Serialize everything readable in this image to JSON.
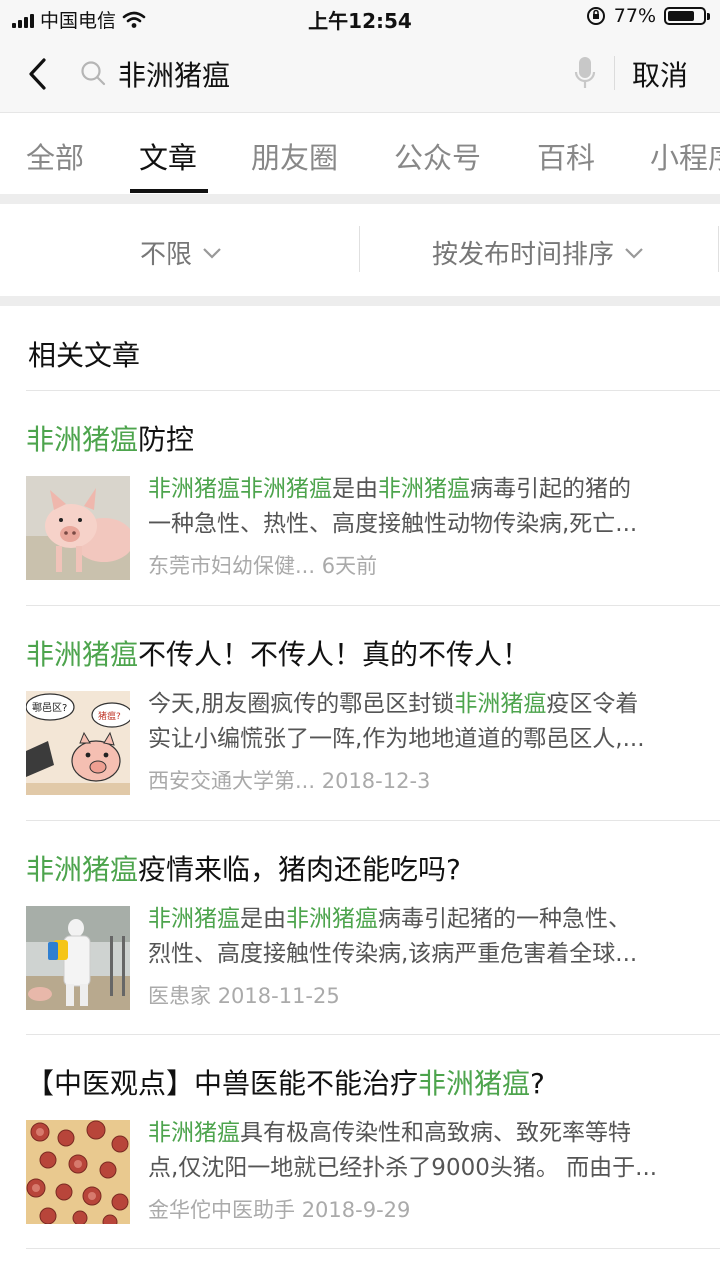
{
  "status_bar": {
    "carrier": "中国电信",
    "time": "上午12:54",
    "battery": "77%",
    "battery_level": 0.77
  },
  "search": {
    "query": "非洲猪瘟",
    "cancel": "取消"
  },
  "tabs": [
    "全部",
    "文章",
    "朋友圈",
    "公众号",
    "百科",
    "小程序"
  ],
  "active_tab": "文章",
  "filters": {
    "range": "不限",
    "sort": "按发布时间排序"
  },
  "section_title": "相关文章",
  "articles": [
    {
      "title": [
        {
          "t": "非洲猪瘟",
          "hl": true
        },
        {
          "t": "防控",
          "hl": false
        }
      ],
      "snippet1": [
        {
          "t": "非洲猪瘟",
          "hl": true
        },
        {
          "t": "非洲猪瘟",
          "hl": true
        },
        {
          "t": "是由",
          "hl": false
        },
        {
          "t": "非洲猪瘟",
          "hl": true
        },
        {
          "t": "病毒引起的猪的",
          "hl": false
        }
      ],
      "snippet2": "一种急性、热性、高度接触性动物传染病,死亡...",
      "source": "东莞市妇幼保健...",
      "date": "6天前",
      "thumb": "pig-photo"
    },
    {
      "title": [
        {
          "t": "非洲猪瘟",
          "hl": true
        },
        {
          "t": "不传人！不传人！真的不传人！",
          "hl": false
        }
      ],
      "snippet1": [
        {
          "t": "今天,朋友圈疯传的鄠邑区封锁",
          "hl": false
        },
        {
          "t": "非洲猪瘟",
          "hl": true
        },
        {
          "t": "疫区令着",
          "hl": false
        }
      ],
      "snippet2": "实让小编慌张了一阵,作为地地道道的鄠邑区人,...",
      "source": "西安交通大学第...",
      "date": "2018-12-3",
      "thumb": "pig-cartoon",
      "thumb_bubble_1": "鄠邑区?",
      "thumb_bubble_2": "猪瘟?"
    },
    {
      "title": [
        {
          "t": "非洲猪瘟",
          "hl": true
        },
        {
          "t": "疫情来临，猪肉还能吃吗?",
          "hl": false
        }
      ],
      "snippet1": [
        {
          "t": "非洲猪瘟",
          "hl": true
        },
        {
          "t": "是由",
          "hl": false
        },
        {
          "t": "非洲猪瘟",
          "hl": true
        },
        {
          "t": "病毒引起猪的一种急性、",
          "hl": false
        }
      ],
      "snippet2": "烈性、高度接触性传染病,该病严重危害着全球...",
      "source": "医患家",
      "date": "2018-11-25",
      "thumb": "worker-spraying"
    },
    {
      "title": [
        {
          "t": "【中医观点】中兽医能不能治疗",
          "hl": false
        },
        {
          "t": "非洲猪瘟",
          "hl": true
        },
        {
          "t": "?",
          "hl": false
        }
      ],
      "snippet1": [
        {
          "t": "非洲猪瘟",
          "hl": true
        },
        {
          "t": "具有极高传染性和高致病、致死率等特",
          "hl": false
        }
      ],
      "snippet2": "点,仅沈阳一地就已经扑杀了9000头猪。 而由于...",
      "source": "金华佗中医助手",
      "date": "2018-9-29",
      "thumb": "virus-microscope"
    }
  ]
}
